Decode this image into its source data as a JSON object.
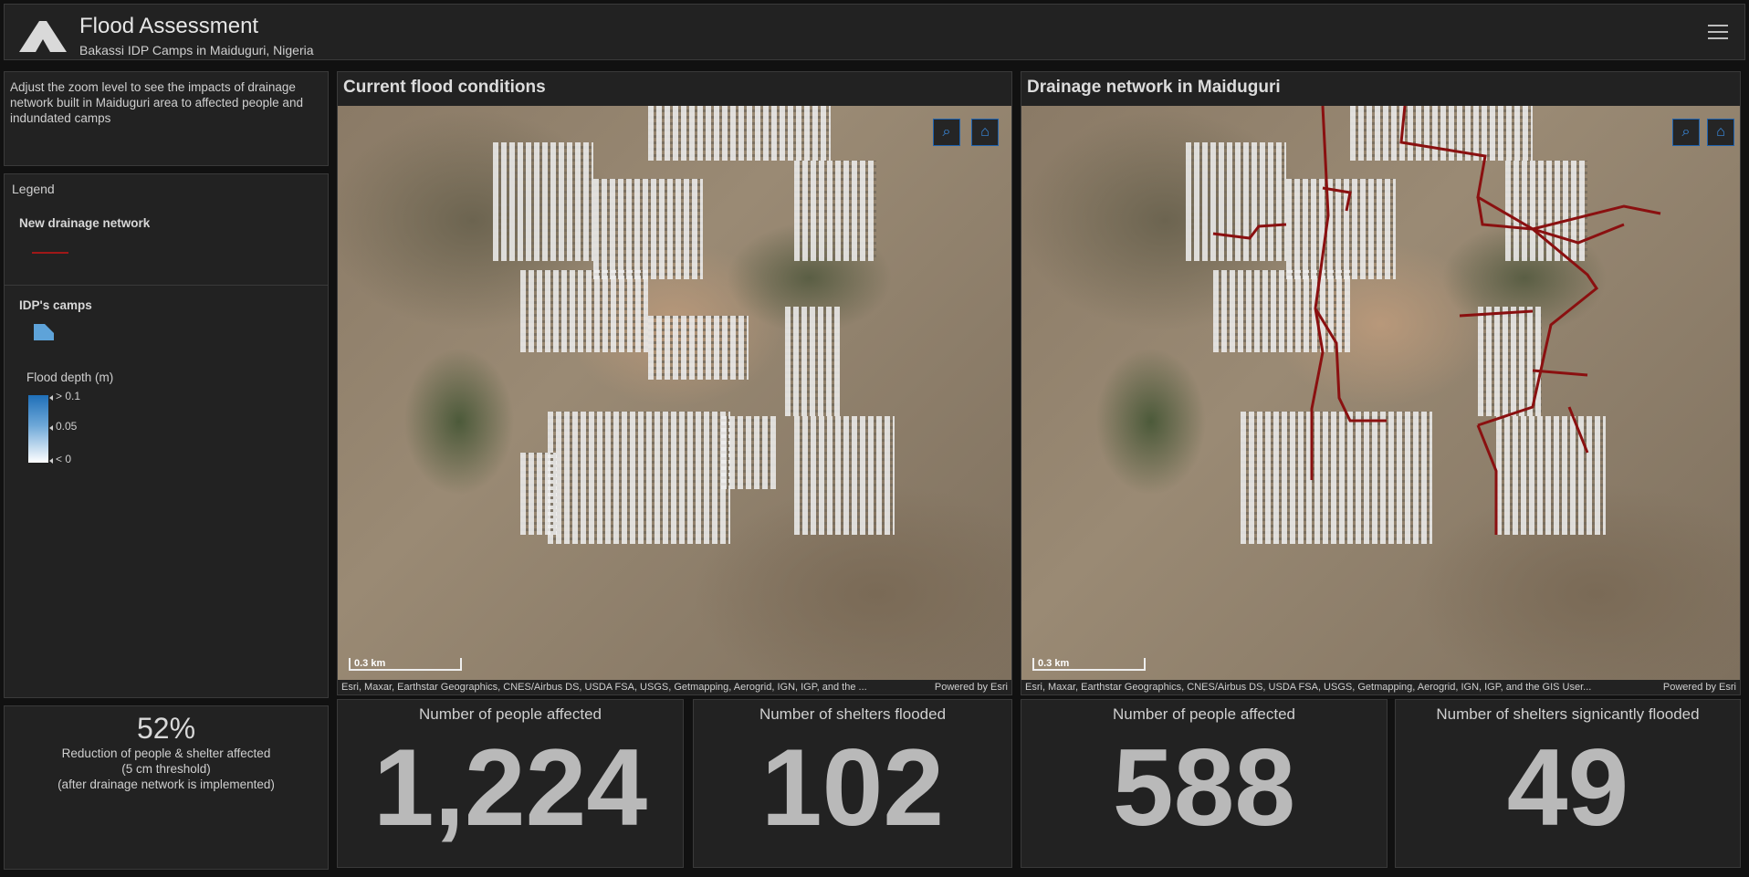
{
  "header": {
    "title": "Flood Assessment",
    "subtitle": "Bakassi IDP Camps in Maiduguri, Nigeria",
    "icons": {
      "logo": "tent-icon",
      "menu": "hamburger-menu-icon"
    }
  },
  "intro": {
    "text": "Adjust the zoom level to see the impacts of drainage network built in Maiduguri area to affected people and indundated camps"
  },
  "legend": {
    "title": "Legend",
    "layer1_title": "New drainage network",
    "layer1_color": "#a01818",
    "layer2_title": "IDP's camps",
    "layer2_color": "#5ea3d9",
    "depth_title": "Flood depth (m)",
    "depth_labels": [
      "> 0.1",
      "0.05",
      "< 0"
    ]
  },
  "maps": {
    "left": {
      "title": "Current flood conditions",
      "scale_label": "0.3 km",
      "attribution": "Esri, Maxar, Earthstar Geographics, CNES/Airbus DS, USDA FSA, USGS, Getmapping, Aerogrid, IGN, IGP, and the ...",
      "powered": "Powered by Esri"
    },
    "right": {
      "title": "Drainage network in Maiduguri",
      "scale_label": "0.3 km",
      "attribution": "Esri, Maxar, Earthstar Geographics, CNES/Airbus DS, USDA FSA, USGS, Getmapping, Aerogrid, IGN, IGP, and the GIS User...",
      "powered": "Powered by Esri"
    },
    "icons": {
      "search": "search-icon",
      "home": "home-icon"
    }
  },
  "indicators": {
    "reduction": {
      "value": "52%",
      "line1": "Reduction of people & shelter affected",
      "line2": "(5 cm threshold)",
      "line3": "(after drainage network is implemented)"
    },
    "people_current": {
      "title": "Number of people affected",
      "value": "1,224"
    },
    "shelters_current": {
      "title": "Number of shelters flooded",
      "value": "102"
    },
    "people_after": {
      "title": "Number of people affected",
      "value": "588"
    },
    "shelters_after": {
      "title": "Number of shelters signicantly flooded",
      "value": "49"
    }
  }
}
